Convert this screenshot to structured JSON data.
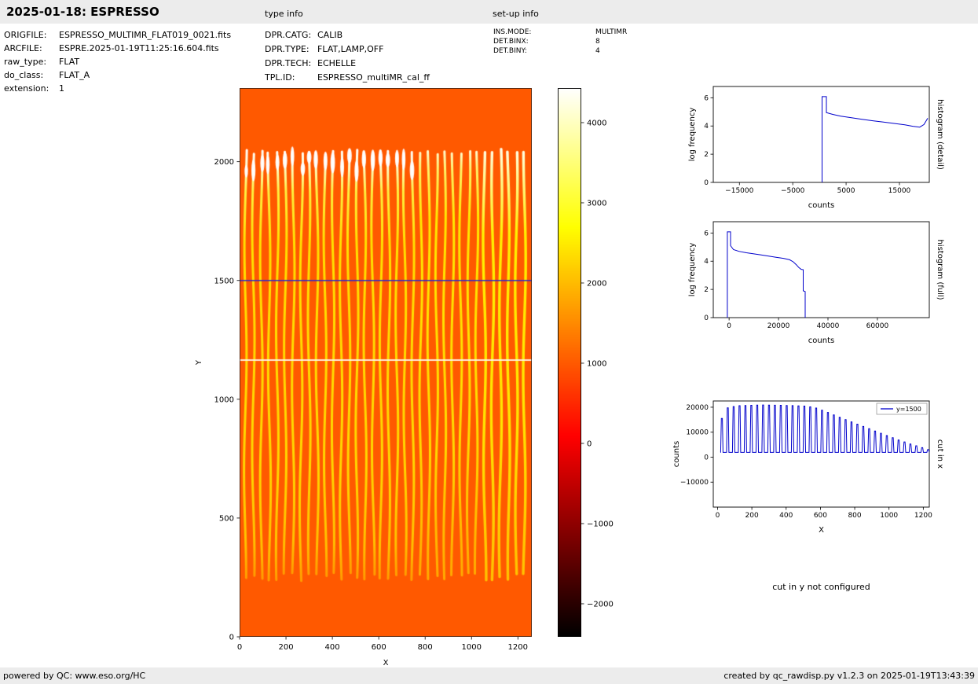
{
  "header": {
    "title": "2025-01-18: ESPRESSO",
    "type_info_label": "type info",
    "setup_info_label": "set-up info"
  },
  "file_info": [
    {
      "label": "ORIGFILE:",
      "value": "ESPRESSO_MULTIMR_FLAT019_0021.fits"
    },
    {
      "label": "ARCFILE:",
      "value": "ESPRE.2025-01-19T11:25:16.604.fits"
    },
    {
      "label": "raw_type:",
      "value": "FLAT"
    },
    {
      "label": "do_class:",
      "value": "FLAT_A"
    },
    {
      "label": "extension:",
      "value": "1"
    }
  ],
  "type_info": [
    {
      "label": "DPR.CATG:",
      "value": "CALIB"
    },
    {
      "label": "DPR.TYPE:",
      "value": "FLAT,LAMP,OFF"
    },
    {
      "label": "DPR.TECH:",
      "value": "ECHELLE"
    },
    {
      "label": "TPL.ID:",
      "value": "ESPRESSO_multiMR_cal_ff"
    }
  ],
  "setup_info": [
    {
      "label": "INS.MODE:",
      "value": "MULTIMR"
    },
    {
      "label": "DET.BINX:",
      "value": "8"
    },
    {
      "label": "DET.BINY:",
      "value": "4"
    }
  ],
  "notes": {
    "cut_y": "cut in y not configured"
  },
  "footer": {
    "left": "powered by QC: www.eso.org/HC",
    "right": "created by qc_rawdisp.py v1.2.3 on 2025-01-19T13:43:39"
  },
  "chart_data": [
    {
      "id": "raw_image",
      "type": "heatmap",
      "xlabel": "X",
      "ylabel": "Y",
      "xlim": [
        0,
        1260
      ],
      "ylim": [
        0,
        2310
      ],
      "xticks": [
        0,
        200,
        400,
        600,
        800,
        1000,
        1200
      ],
      "yticks": [
        0,
        500,
        1000,
        1500,
        2000
      ],
      "colormap": "hot",
      "background_counts": 1000,
      "order_stripes": {
        "count": 36,
        "x_first": 25,
        "x_last": 1228,
        "y_bottom": 245,
        "y_top": 2055,
        "peak_counts": 2600
      },
      "cut_line": {
        "y": 1500,
        "color": "#2b2bcd"
      },
      "bright_row_y": 1165,
      "colorbar": {
        "vmin": -2412,
        "vmax": 4431,
        "ticks": [
          4000,
          3000,
          2000,
          1000,
          0,
          -1000,
          -2000
        ]
      }
    },
    {
      "id": "histogram_detail",
      "type": "line",
      "xlabel": "counts",
      "ylabel": "log frequency",
      "right_label": "histogram (detail)",
      "color": "#0000cc",
      "xlim": [
        -19900,
        20600
      ],
      "ylim": [
        0,
        6.8
      ],
      "xticks": [
        -15000,
        -5000,
        5000,
        15000
      ],
      "yticks": [
        0,
        2,
        4,
        6
      ],
      "points": [
        [
          500,
          0
        ],
        [
          500,
          6.08
        ],
        [
          1300,
          6.08
        ],
        [
          1300,
          4.95
        ],
        [
          2500,
          4.82
        ],
        [
          4000,
          4.7
        ],
        [
          6000,
          4.58
        ],
        [
          8000,
          4.47
        ],
        [
          10000,
          4.37
        ],
        [
          12000,
          4.28
        ],
        [
          14000,
          4.18
        ],
        [
          16000,
          4.08
        ],
        [
          17500,
          3.98
        ],
        [
          18800,
          3.92
        ],
        [
          19600,
          4.1
        ],
        [
          20300,
          4.55
        ]
      ]
    },
    {
      "id": "histogram_full",
      "type": "line",
      "xlabel": "counts",
      "ylabel": "log frequency",
      "right_label": "histogram (full)",
      "color": "#0000cc",
      "xlim": [
        -6400,
        81000
      ],
      "ylim": [
        0,
        6.8
      ],
      "xticks": [
        0,
        20000,
        40000,
        60000
      ],
      "yticks": [
        0,
        2,
        4,
        6
      ],
      "points": [
        [
          -700,
          0
        ],
        [
          -700,
          6.08
        ],
        [
          600,
          6.08
        ],
        [
          600,
          5.1
        ],
        [
          1800,
          4.82
        ],
        [
          4000,
          4.7
        ],
        [
          7000,
          4.6
        ],
        [
          10000,
          4.52
        ],
        [
          13000,
          4.44
        ],
        [
          16000,
          4.36
        ],
        [
          19000,
          4.28
        ],
        [
          22000,
          4.2
        ],
        [
          24500,
          4.1
        ],
        [
          26000,
          3.95
        ],
        [
          27200,
          3.75
        ],
        [
          28200,
          3.55
        ],
        [
          29200,
          3.42
        ],
        [
          30000,
          3.4
        ],
        [
          30000,
          1.9
        ],
        [
          30800,
          1.85
        ],
        [
          30800,
          0
        ]
      ]
    },
    {
      "id": "cut_x",
      "type": "line",
      "xlabel": "X",
      "ylabel": "counts",
      "right_label": "cut in x",
      "legend": "y=1500",
      "color": "#0000cc",
      "xlim": [
        -25,
        1235
      ],
      "ylim": [
        -20000,
        22500
      ],
      "xticks": [
        0,
        200,
        400,
        600,
        800,
        1000,
        1200
      ],
      "yticks": [
        -10000,
        0,
        10000,
        20000
      ],
      "spikes": {
        "count": 36,
        "x_first": 25,
        "x_last": 1228,
        "baseline": 1900,
        "half_width": 7,
        "top_width": 6
      },
      "envelope": [
        [
          25,
          15500
        ],
        [
          60,
          19800
        ],
        [
          120,
          20600
        ],
        [
          250,
          20900
        ],
        [
          420,
          20700
        ],
        [
          520,
          20400
        ],
        [
          580,
          19600
        ],
        [
          640,
          18000
        ],
        [
          700,
          16300
        ],
        [
          760,
          14700
        ],
        [
          820,
          13100
        ],
        [
          880,
          11500
        ],
        [
          940,
          9900
        ],
        [
          1000,
          8300
        ],
        [
          1060,
          6800
        ],
        [
          1120,
          5400
        ],
        [
          1180,
          4100
        ],
        [
          1228,
          3000
        ]
      ]
    }
  ]
}
